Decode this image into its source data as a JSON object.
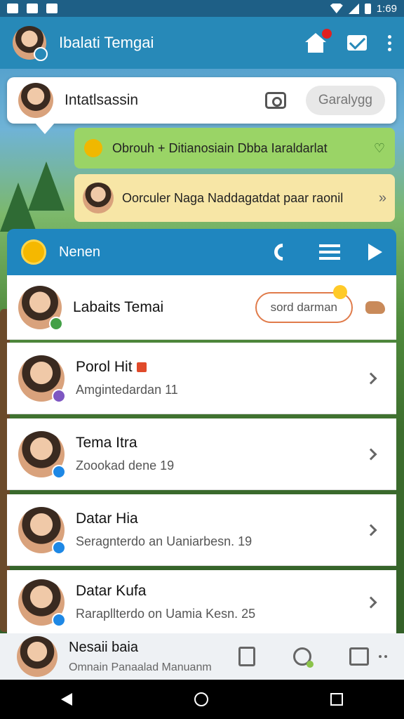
{
  "status_bar": {
    "time": "1:69"
  },
  "app_bar": {
    "title": "Ibalati Temgai",
    "icons": [
      "home-icon",
      "mail-icon",
      "more-icon"
    ]
  },
  "top_card": {
    "name": "Intatlsassin",
    "button": "Garalygg"
  },
  "notice_green": {
    "text": "Obrouh + Ditianosiain Dbba Iaraldarlat"
  },
  "notice_yellow": {
    "text": "Oorculer Naga Naddagatdat paar raonil"
  },
  "section": {
    "label": "Nenen"
  },
  "contacts": [
    {
      "name": "Labaits Temai",
      "button": "sord darman"
    },
    {
      "name": "Porol Hit",
      "subtitle": "Amgintedardan 11"
    },
    {
      "name": "Tema Itra",
      "subtitle": "Zoookad dene 19"
    },
    {
      "name": "Datar Hia",
      "subtitle": "Seragnterdo an Uaniarbesn. 19"
    },
    {
      "name": "Datar Kufa",
      "subtitle": "Rarapllterdo on Uamia Kesn. 25"
    }
  ],
  "bottom_bar": {
    "name": "Nesaii baia",
    "subtitle": "Omnain Panaalad Manuanm"
  },
  "colors": {
    "accent": "#2789b8",
    "green": "#9ad466",
    "yellow": "#f7e6a6",
    "orange": "#e07b4a"
  }
}
